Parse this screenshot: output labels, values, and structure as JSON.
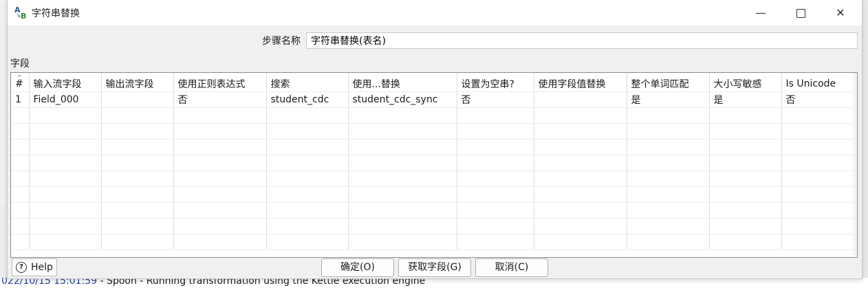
{
  "window": {
    "title": "字符串替换"
  },
  "step_name": {
    "label": "步骤名称",
    "value": "字符串替换(表名)"
  },
  "fields_label": "字段",
  "table": {
    "columns": [
      "#",
      "输入流字段",
      "输出流字段",
      "使用正则表达式",
      "搜索",
      "使用...替换",
      "设置为空串?",
      "使用字段值替换",
      "整个单词匹配",
      "大小写敏感",
      "Is Unicode"
    ],
    "rows": [
      [
        "1",
        "Field_000",
        "",
        "否",
        "student_cdc",
        "student_cdc_sync",
        "否",
        "",
        "是",
        "是",
        "否"
      ]
    ]
  },
  "buttons": {
    "help": "Help",
    "ok": "确定(O)",
    "get_fields": "获取字段(G)",
    "cancel": "取消(C)"
  },
  "background": {
    "status_timestamp": "022/10/15 15:01:59",
    "status_text": " - Spoon - Running transformation using the Kettle execution engine"
  }
}
